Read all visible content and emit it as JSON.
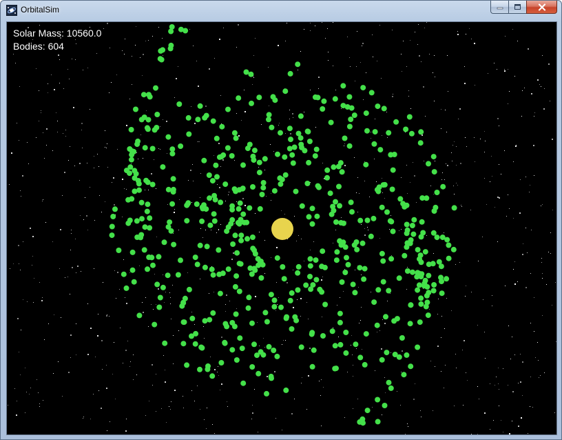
{
  "window": {
    "title": "OrbitalSim",
    "icon": "orbitalsim-app-icon",
    "controls": [
      "minimize-icon",
      "maximize-icon",
      "close-icon"
    ]
  },
  "hud": {
    "solar_mass": "Solar Mass: 10560.0",
    "bodies": "Bodies: 604"
  },
  "scene": {
    "background_color": "#000000",
    "star_color": "#ffffff",
    "sun_color": "#e8d44d",
    "body_color": "#44e04a"
  }
}
